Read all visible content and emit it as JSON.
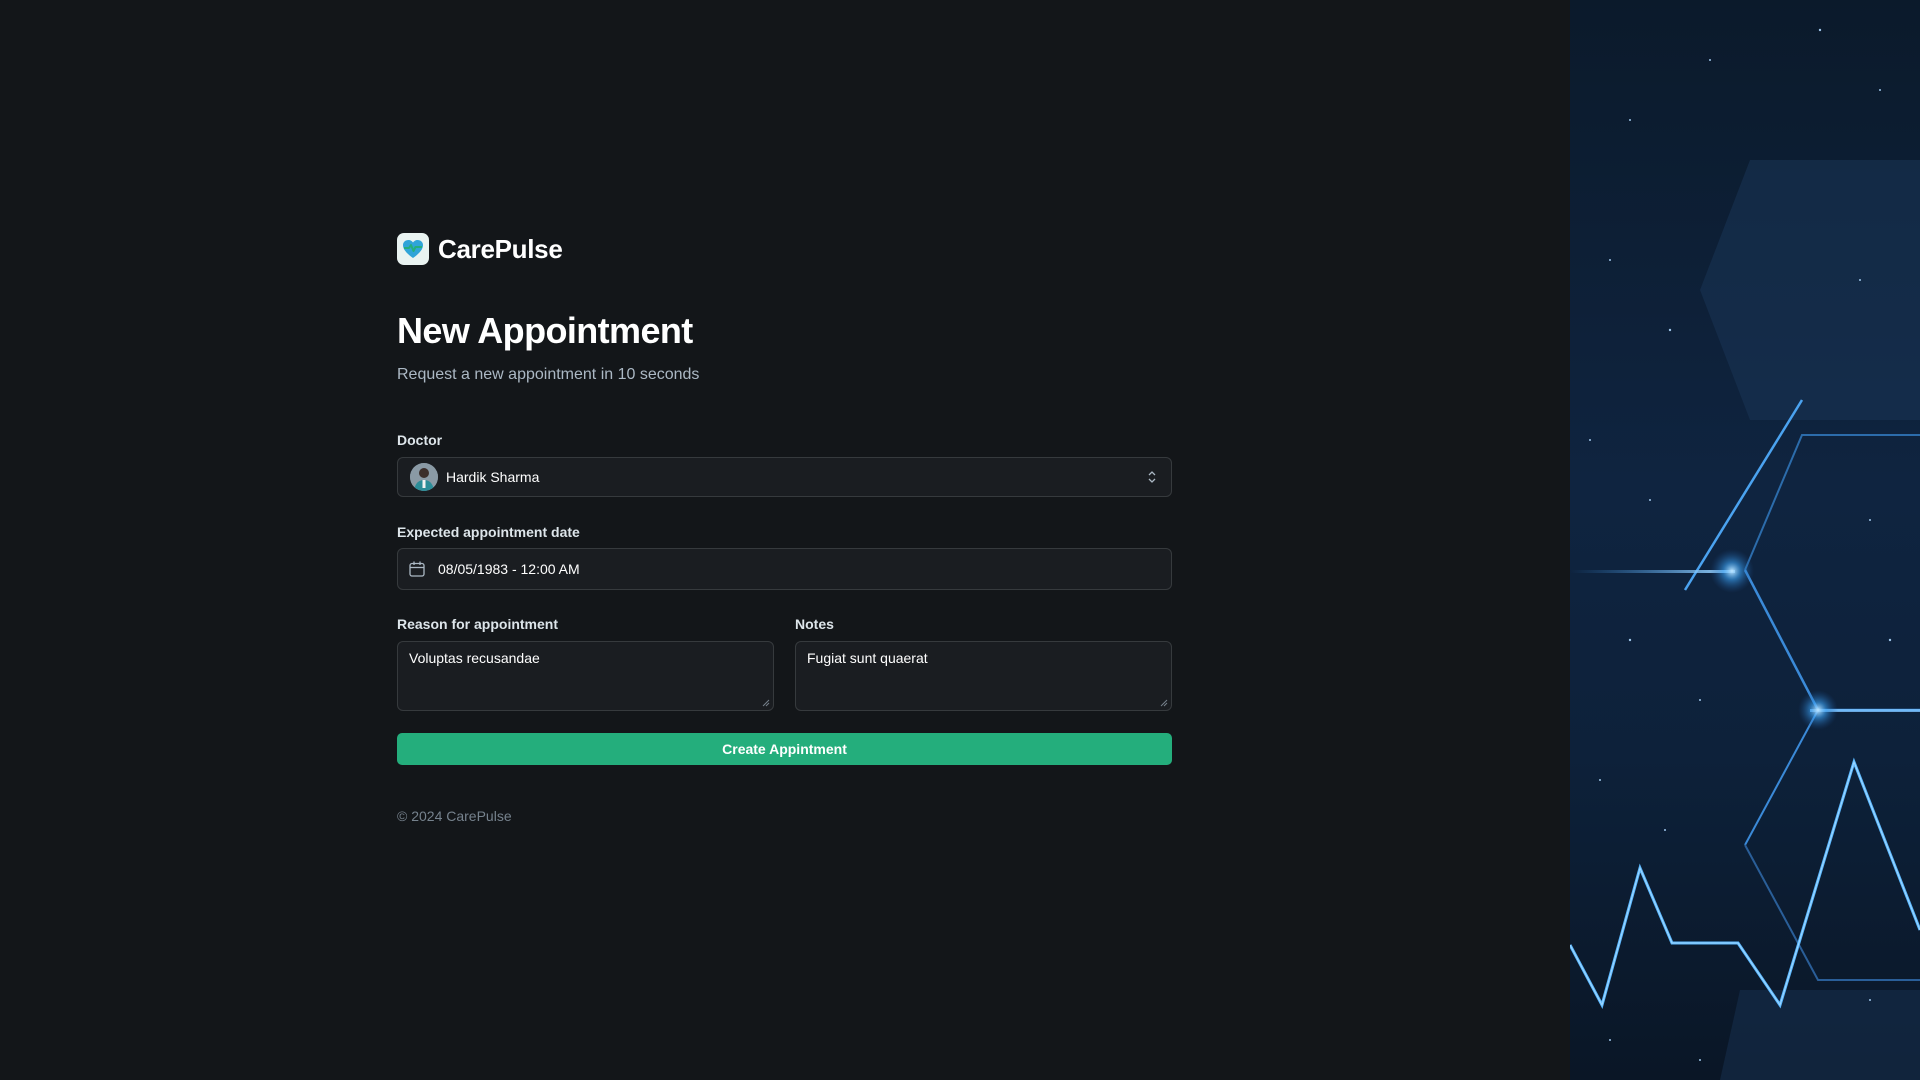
{
  "brand": {
    "name": "CarePulse"
  },
  "header": {
    "title": "New Appointment",
    "subtitle": "Request a new appointment in 10 seconds"
  },
  "form": {
    "doctor": {
      "label": "Doctor",
      "value": "Hardik Sharma"
    },
    "date": {
      "label": "Expected appointment date",
      "value": "08/05/1983 - 12:00 AM"
    },
    "reason": {
      "label": "Reason for appointment",
      "value": "Voluptas recusandae"
    },
    "notes": {
      "label": "Notes",
      "value": "Fugiat sunt quaerat"
    },
    "submit_label": "Create Appintment"
  },
  "footer": {
    "copyright": "© 2024 CarePulse"
  },
  "colors": {
    "background": "#131619",
    "input_background": "#1a1d21",
    "input_border": "#363a3d",
    "accent_green": "#24ae7c",
    "subtitle": "#abb8c4",
    "footer_text": "#76828d"
  },
  "icons": {
    "logo": "heart-pulse-logo-icon",
    "avatar": "doctor-avatar",
    "select_chevron": "chevron-up-down-icon",
    "date": "calendar-icon"
  }
}
